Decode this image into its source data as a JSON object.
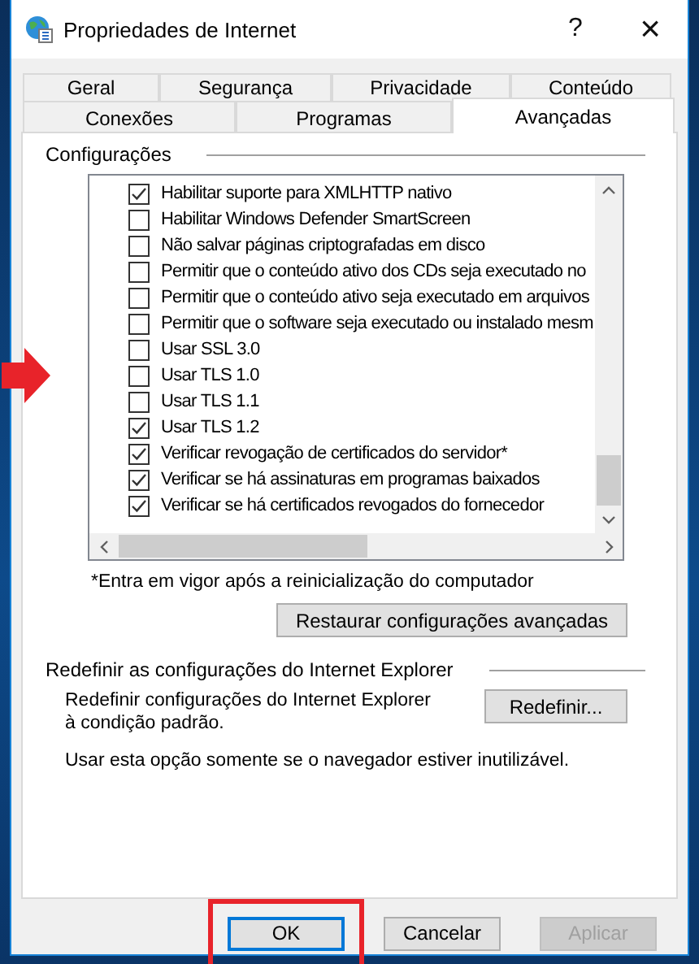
{
  "window": {
    "title": "Propriedades de Internet",
    "help": "?",
    "close": "×"
  },
  "tabs_back": [
    {
      "label": "Geral",
      "selected": false
    },
    {
      "label": "Segurança",
      "selected": false
    },
    {
      "label": "Privacidade",
      "selected": false
    },
    {
      "label": "Conteúdo",
      "selected": false
    }
  ],
  "tabs_front": [
    {
      "label": "Conexões",
      "selected": false
    },
    {
      "label": "Programas",
      "selected": false
    },
    {
      "label": "Avançadas",
      "selected": true
    }
  ],
  "settings": {
    "title": "Configurações",
    "items": [
      {
        "label": "Habilitar suporte para XMLHTTP nativo",
        "checked": true,
        "highlighted": false
      },
      {
        "label": "Habilitar Windows Defender SmartScreen",
        "checked": false,
        "highlighted": false
      },
      {
        "label": "Não salvar páginas criptografadas em disco",
        "checked": false,
        "highlighted": false
      },
      {
        "label": "Permitir que o conteúdo ativo dos CDs seja executado no",
        "checked": false,
        "highlighted": false
      },
      {
        "label": "Permitir que o conteúdo ativo seja executado em arquivos",
        "checked": false,
        "highlighted": false
      },
      {
        "label": "Permitir que o software seja executado ou instalado mesm",
        "checked": false,
        "highlighted": false
      },
      {
        "label": "Usar SSL 3.0",
        "checked": false,
        "highlighted": false
      },
      {
        "label": "Usar TLS 1.0",
        "checked": false,
        "highlighted": true
      },
      {
        "label": "Usar TLS 1.1",
        "checked": false,
        "highlighted": false
      },
      {
        "label": "Usar TLS 1.2",
        "checked": true,
        "highlighted": false
      },
      {
        "label": "Verificar revogação de certificados do servidor*",
        "checked": true,
        "highlighted": false
      },
      {
        "label": "Verificar se há assinaturas em programas baixados",
        "checked": true,
        "highlighted": false
      },
      {
        "label": "Verificar se há certificados revogados do fornecedor",
        "checked": true,
        "highlighted": false
      }
    ],
    "footnote": "*Entra em vigor após a reinicialização do computador",
    "restore_button": "Restaurar configurações avançadas"
  },
  "reset": {
    "title": "Redefinir as configurações do Internet Explorer",
    "description": "Redefinir configurações do Internet Explorer à condição padrão.",
    "button": "Redefinir...",
    "note": "Usar esta opção somente se o navegador estiver inutilizável."
  },
  "buttons": [
    {
      "label": "OK",
      "disabled": false,
      "default": true,
      "highlighted": true
    },
    {
      "label": "Cancelar",
      "disabled": false,
      "default": false,
      "highlighted": false
    },
    {
      "label": "Aplicar",
      "disabled": true,
      "default": false,
      "highlighted": false
    }
  ]
}
